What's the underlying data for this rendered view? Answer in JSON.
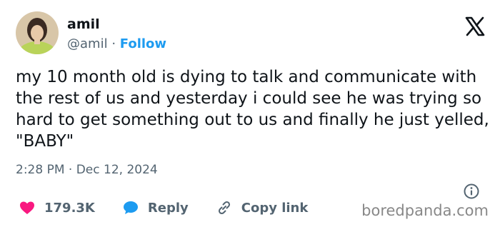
{
  "user": {
    "display_name": "amil",
    "handle": "@amil",
    "separator": "·",
    "follow_label": "Follow",
    "avatar_icon": "avatar-photo"
  },
  "brand": {
    "logo_icon": "x-logo-icon",
    "watermark": "boredpanda.com"
  },
  "tweet": {
    "text": "my 10 month old is dying to talk and communicate with the rest of us and yesterday i could see he was trying so hard to get something out to us and finally he just yelled, \"BABY\"",
    "timestamp": "2:28 PM · Dec 12, 2024"
  },
  "actions": {
    "like": {
      "icon": "heart-icon",
      "count": "179.3K",
      "color": "#f91880"
    },
    "reply": {
      "icon": "speech-bubble-icon",
      "label": "Reply",
      "color": "#1d9bf0"
    },
    "copy_link": {
      "icon": "link-icon",
      "label": "Copy link"
    }
  },
  "colors": {
    "accent": "#1d9bf0",
    "text": "#0f1419",
    "muted": "#536471"
  }
}
